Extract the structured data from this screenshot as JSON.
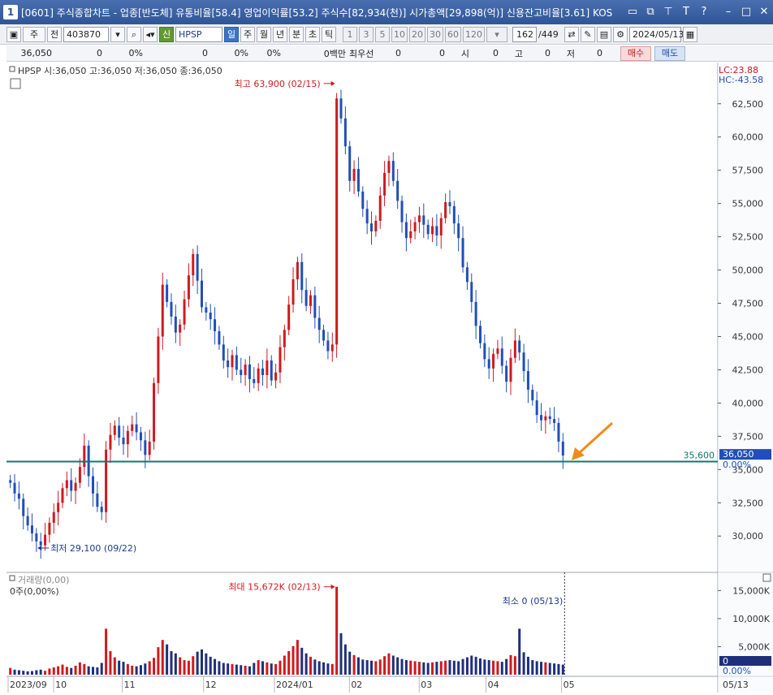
{
  "window": {
    "number": "1",
    "title": "[0601] 주식종합차트 - 업종[반도체] 유통비율[58.4] 영업이익률[53.2] 주식수[82,934(천)] 시가총액[29,898(억)] 신용잔고비율[3.61] KOS"
  },
  "toolbar": {
    "period_unit": "주",
    "prev_label": "전",
    "code": "403870",
    "stock_badge": "신",
    "stock_name": "HPSP",
    "periods": [
      "일",
      "주",
      "월",
      "년",
      "분",
      "초",
      "틱"
    ],
    "active_period": "일",
    "intervals": [
      "1",
      "3",
      "5",
      "10",
      "20",
      "30",
      "60",
      "120"
    ],
    "count": "162",
    "count_total": "/449",
    "date": "2024/05/13"
  },
  "quote": {
    "price": "36,050",
    "change": "0",
    "change_pct": "0%",
    "volume": "0",
    "vol_pct": "0%",
    "amt_pct": "0%",
    "amount": "0백만",
    "best_label": "최우선",
    "best_ask": "0",
    "best_bid": "0",
    "open_label": "시",
    "open": "0",
    "high_label": "고",
    "high": "0",
    "low_label": "저",
    "low": "0",
    "buy_label": "매수",
    "sell_label": "매도"
  },
  "price_panel": {
    "legend": "HPSP 시:36,050 고:36,050 저:36,050 종:36,050",
    "lc": "LC:23.88",
    "hc": "HC:-43.58",
    "high_note": "최고 63,900 (02/15)",
    "low_note": "최저 29,100 (09/22)",
    "hline_value": "35,600",
    "current_price": "36,050",
    "current_pct": "0.00%",
    "y_ticks": [
      "62,500",
      "60,000",
      "57,500",
      "55,000",
      "52,500",
      "50,000",
      "47,500",
      "45,000",
      "42,500",
      "40,000",
      "37,500",
      "35,000",
      "32,500",
      "30,000"
    ]
  },
  "volume_panel": {
    "legend": "거래량(0,00)",
    "sub_legend": "0주(0,00%)",
    "max_note": "최대 15,672K (02/13)",
    "min_note": "최소 0 (05/13)",
    "current": "0",
    "current_pct": "0.00%",
    "y_ticks": [
      "15,000K",
      "10,000K",
      "5,000K"
    ]
  },
  "x_axis": {
    "labels": [
      "2023/09",
      "10",
      "11",
      "12",
      "2024/01",
      "02",
      "03",
      "04",
      "05"
    ],
    "end_label": "05/13"
  },
  "colors": {
    "up": "#d0191f",
    "down": "#1f4fb8",
    "hline": "#0e7a6c",
    "arrow": "#f08a1c",
    "buy": "#c02020",
    "sell": "#1a4a9a",
    "title_bg": "#2f5597"
  },
  "chart_data": {
    "type": "candlestick",
    "title": "HPSP",
    "x_start": "2023/09",
    "x_end": "2024/05/13",
    "x_month_ticks": [
      "2023/09",
      "10",
      "11",
      "12",
      "2024/01",
      "02",
      "03",
      "04",
      "05"
    ],
    "y_range": [
      28000,
      64500
    ],
    "price_high": {
      "value": 63900,
      "date": "02/15"
    },
    "price_low": {
      "value": 29100,
      "date": "09/22"
    },
    "last_close": 36050,
    "horizontal_line": 35600,
    "close_series": [
      34000,
      33200,
      32800,
      31500,
      30800,
      30200,
      29600,
      29300,
      30100,
      31000,
      31800,
      32500,
      33600,
      34200,
      33400,
      34000,
      35200,
      36800,
      34500,
      33200,
      32200,
      31800,
      36500,
      37600,
      38300,
      37400,
      36900,
      37900,
      38400,
      37800,
      37200,
      36100,
      37100,
      41500,
      45000,
      48900,
      47600,
      46500,
      45300,
      45900,
      47800,
      49600,
      51200,
      49200,
      47200,
      46800,
      46300,
      45400,
      44400,
      43200,
      42700,
      43600,
      42500,
      42100,
      42900,
      41800,
      41500,
      42600,
      42100,
      43200,
      41700,
      42300,
      44200,
      45500,
      47400,
      49300,
      50600,
      48500,
      47300,
      48100,
      46400,
      45500,
      44700,
      43900,
      44400,
      62900,
      61400,
      59300,
      56700,
      57600,
      55900,
      54600,
      53500,
      52900,
      53700,
      55600,
      57300,
      58200,
      56700,
      55200,
      53600,
      52400,
      52900,
      53600,
      54100,
      53400,
      52700,
      53300,
      52600,
      53900,
      55100,
      54800,
      53500,
      52400,
      50200,
      49100,
      47600,
      45800,
      44500,
      43300,
      42600,
      43700,
      44100,
      42800,
      41600,
      43400,
      44700,
      43800,
      42400,
      41000,
      40200,
      39100,
      38700,
      39000,
      38800,
      38500,
      37100,
      36050
    ],
    "volume_series_k": [
      1200,
      900,
      800,
      700,
      600,
      650,
      800,
      900,
      700,
      1100,
      1300,
      1500,
      1800,
      1400,
      1200,
      1600,
      2200,
      1900,
      1500,
      1400,
      1300,
      2100,
      8200,
      4200,
      3100,
      2500,
      2300,
      1900,
      1600,
      1500,
      1700,
      2000,
      2400,
      3000,
      4900,
      6200,
      5400,
      4200,
      3800,
      3100,
      2600,
      2500,
      3300,
      4100,
      4500,
      3800,
      3200,
      2800,
      2400,
      2100,
      2000,
      1900,
      1800,
      1700,
      1600,
      1500,
      2100,
      2600,
      2400,
      2200,
      2000,
      1900,
      2500,
      3400,
      4200,
      5100,
      6200,
      4800,
      3800,
      3200,
      2700,
      2400,
      2200,
      2000,
      1900,
      15672,
      7400,
      5400,
      4100,
      3500,
      3100,
      2700,
      2600,
      2500,
      2400,
      2700,
      3300,
      3800,
      3400,
      3100,
      2800,
      2600,
      2500,
      2400,
      2300,
      2200,
      2100,
      2200,
      2300,
      2400,
      2500,
      2600,
      2500,
      2400,
      2800,
      3100,
      3400,
      3200,
      2900,
      2700,
      2600,
      2500,
      2400,
      2300,
      2800,
      3500,
      3300,
      8200,
      4000,
      3200,
      2600,
      2400,
      2300,
      2200,
      2100,
      2000,
      1900,
      1800,
      0
    ]
  }
}
